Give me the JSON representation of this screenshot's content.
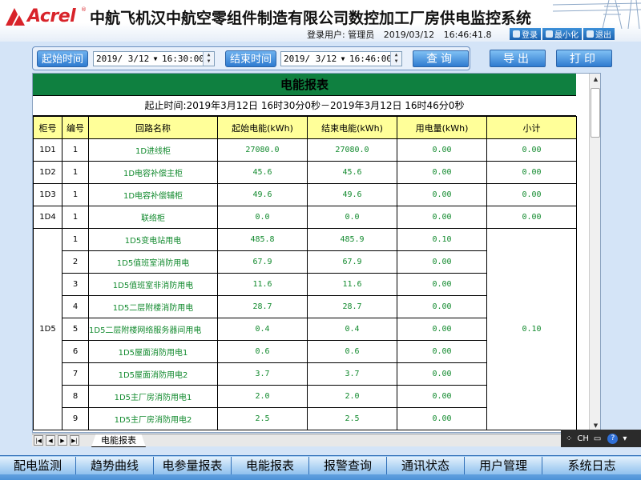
{
  "brand": {
    "logo_text": "Acrel",
    "reg_mark": "®"
  },
  "header": {
    "system_title": "中航飞机汉中航空零组件制造有限公司数控加工厂房供电监控系统",
    "user_label": "登录用户: 管理员",
    "date": "2019/03/12",
    "time": "16:46:41.8",
    "buttons": [
      {
        "label": "登录",
        "icon": "login-icon"
      },
      {
        "label": "最小化",
        "icon": "minimize-icon"
      },
      {
        "label": "退出",
        "icon": "exit-icon"
      }
    ]
  },
  "query": {
    "start_label": "起始时间",
    "start_date": "2019/ 3/12",
    "start_time": "16:30:00",
    "end_label": "结束时间",
    "end_date": "2019/ 3/12",
    "end_time": "16:46:00",
    "search_label": "查询",
    "export_label": "导出",
    "print_label": "打印"
  },
  "report": {
    "title": "电能报表",
    "subtitle": "起止时间:2019年3月12日 16时30分0秒－2019年3月12日 16时46分0秒",
    "columns": [
      "柜号",
      "编号",
      "回路名称",
      "起始电能(kWh)",
      "结束电能(kWh)",
      "用电量(kWh)",
      "小计"
    ],
    "rows": [
      {
        "cabinet": "1D1",
        "no": "1",
        "name": "1D进线柜",
        "start": "27080.0",
        "end": "27080.0",
        "usage": "0.00",
        "subtotal": "0.00"
      },
      {
        "cabinet": "1D2",
        "no": "1",
        "name": "1D电容补偿主柜",
        "start": "45.6",
        "end": "45.6",
        "usage": "0.00",
        "subtotal": "0.00"
      },
      {
        "cabinet": "1D3",
        "no": "1",
        "name": "1D电容补偿辅柜",
        "start": "49.6",
        "end": "49.6",
        "usage": "0.00",
        "subtotal": "0.00"
      },
      {
        "cabinet": "1D4",
        "no": "1",
        "name": "联络柜",
        "start": "0.0",
        "end": "0.0",
        "usage": "0.00",
        "subtotal": "0.00"
      }
    ],
    "group": {
      "cabinet": "1D5",
      "subtotal": "0.10",
      "rows": [
        {
          "no": "1",
          "name": "1D5变电站用电",
          "start": "485.8",
          "end": "485.9",
          "usage": "0.10"
        },
        {
          "no": "2",
          "name": "1D5值班室消防用电",
          "start": "67.9",
          "end": "67.9",
          "usage": "0.00"
        },
        {
          "no": "3",
          "name": "1D5值班室非消防用电",
          "start": "11.6",
          "end": "11.6",
          "usage": "0.00"
        },
        {
          "no": "4",
          "name": "1D5二层附楼消防用电",
          "start": "28.7",
          "end": "28.7",
          "usage": "0.00"
        },
        {
          "no": "5",
          "name": "1D5二层附楼网络服务器间用电",
          "start": "0.4",
          "end": "0.4",
          "usage": "0.00"
        },
        {
          "no": "6",
          "name": "1D5屋面消防用电1",
          "start": "0.6",
          "end": "0.6",
          "usage": "0.00"
        },
        {
          "no": "7",
          "name": "1D5屋面消防用电2",
          "start": "3.7",
          "end": "3.7",
          "usage": "0.00"
        },
        {
          "no": "8",
          "name": "1D5主厂房消防用电1",
          "start": "2.0",
          "end": "2.0",
          "usage": "0.00"
        },
        {
          "no": "9",
          "name": "1D5主厂房消防用电2",
          "start": "2.5",
          "end": "2.5",
          "usage": "0.00"
        }
      ]
    }
  },
  "sheet": {
    "tab_label": "电能报表"
  },
  "ime": {
    "lang": "CH"
  },
  "bottom_nav": [
    "配电监测",
    "趋势曲线",
    "电参量报表",
    "电能报表",
    "报警查询",
    "通讯状态",
    "用户管理",
    "系统日志"
  ],
  "colors": {
    "title_green": "#0f8040",
    "header_yellow": "#ffff99",
    "text_green": "#128a2e",
    "brand_red": "#d8232a",
    "nav_blue": "#4c92d8"
  }
}
